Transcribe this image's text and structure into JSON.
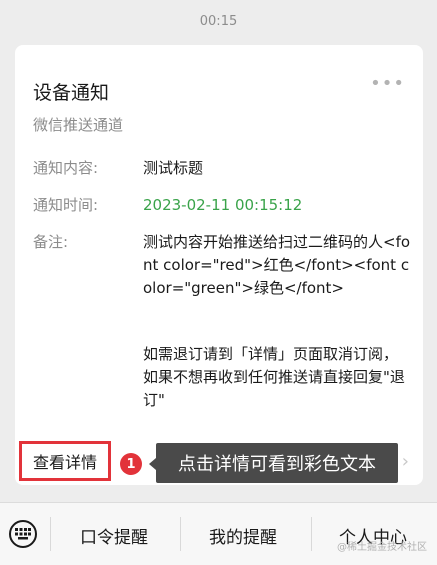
{
  "header": {
    "time": "00:15"
  },
  "card": {
    "title": "设备通知",
    "subtitle": "微信推送通道",
    "more": "•••",
    "rows": [
      {
        "label": "通知内容:",
        "value": "测试标题"
      },
      {
        "label": "通知时间:",
        "value": "2023-02-11 00:15:12"
      },
      {
        "label": "备注:",
        "value": "测试内容开始推送给扫过二维码的人<font color=\"red\">红色</font><font color=\"green\">绿色</font>"
      }
    ],
    "note_extra": "如需退订请到「详情」页面取消订阅，如果不想再收到任何推送请直接回复\"退订\"",
    "detail_button": "查看详情",
    "annotation_number": "1",
    "annotation_tip": "点击详情可看到彩色文本",
    "accent_color": "#e2333a",
    "time_color": "#3aa34a"
  },
  "menu": {
    "items": [
      "口令提醒",
      "我的提醒",
      "个人中心"
    ],
    "keyboard_icon": "keyboard-icon"
  },
  "watermark": "@稀土掘金技术社区"
}
